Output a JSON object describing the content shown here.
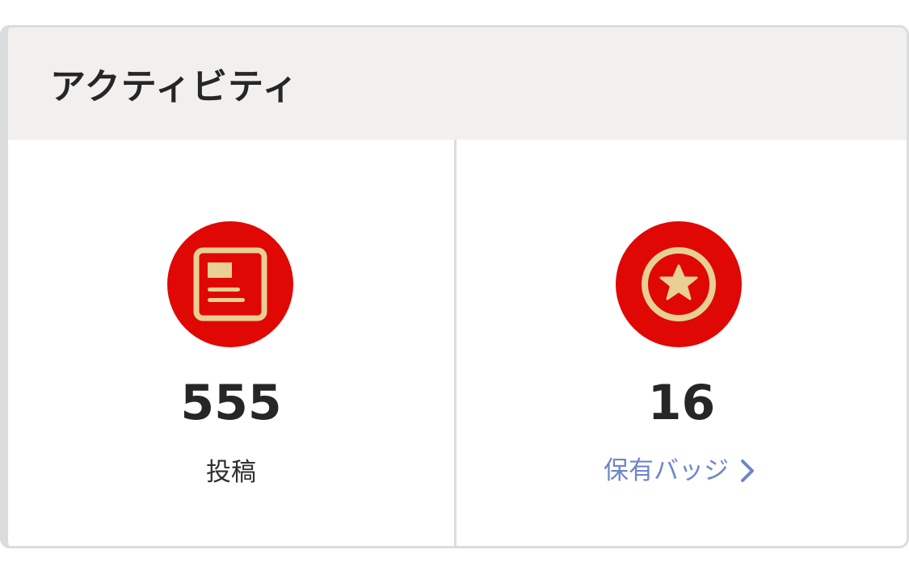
{
  "activity": {
    "title": "アクティビティ",
    "posts": {
      "icon": "article-icon",
      "value": "555",
      "label": "投稿"
    },
    "badges": {
      "icon": "star-badge-icon",
      "value": "16",
      "link_label": "保有バッジ",
      "link_icon": "chevron-right-icon"
    }
  },
  "colors": {
    "icon_background": "#e00804",
    "icon_foreground": "#e8cf94",
    "link": "#6e86c7",
    "header_background": "#f2f0ef"
  }
}
